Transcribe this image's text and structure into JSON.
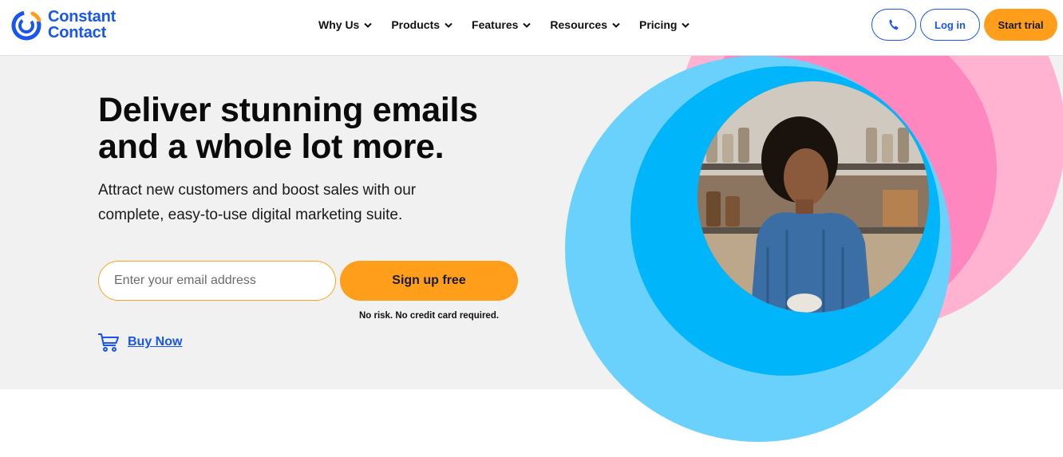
{
  "brand": {
    "line1": "Constant",
    "line2": "Contact",
    "color": "#1856ed"
  },
  "nav": {
    "items": [
      {
        "label": "Why Us"
      },
      {
        "label": "Products"
      },
      {
        "label": "Features"
      },
      {
        "label": "Resources"
      },
      {
        "label": "Pricing"
      }
    ]
  },
  "header_actions": {
    "phone_icon": "phone-icon",
    "login_label": "Log in",
    "trial_label": "Start trial"
  },
  "hero": {
    "headline_line1": "Deliver stunning emails",
    "headline_line2": "and a whole lot more.",
    "sub_line1": "Attract new customers and boost sales with our",
    "sub_line2": "complete, easy-to-use digital marketing suite.",
    "email_placeholder": "Enter your email address",
    "email_value": "",
    "signup_label": "Sign up free",
    "disclaimer": "No risk. No credit card required.",
    "buy_now_label": "Buy Now",
    "buy_now_icon": "cart-icon",
    "photo_icon": "woman-photo"
  },
  "colors": {
    "accent_blue": "#1856ed",
    "accent_orange": "#ff9e1b",
    "hero_bg": "#f1f1f1",
    "circle_light_blue": "#6ad1fd",
    "circle_blue": "#00b5fa",
    "circle_pink_light": "#ffb3d1",
    "circle_pink": "#ff87c0"
  }
}
